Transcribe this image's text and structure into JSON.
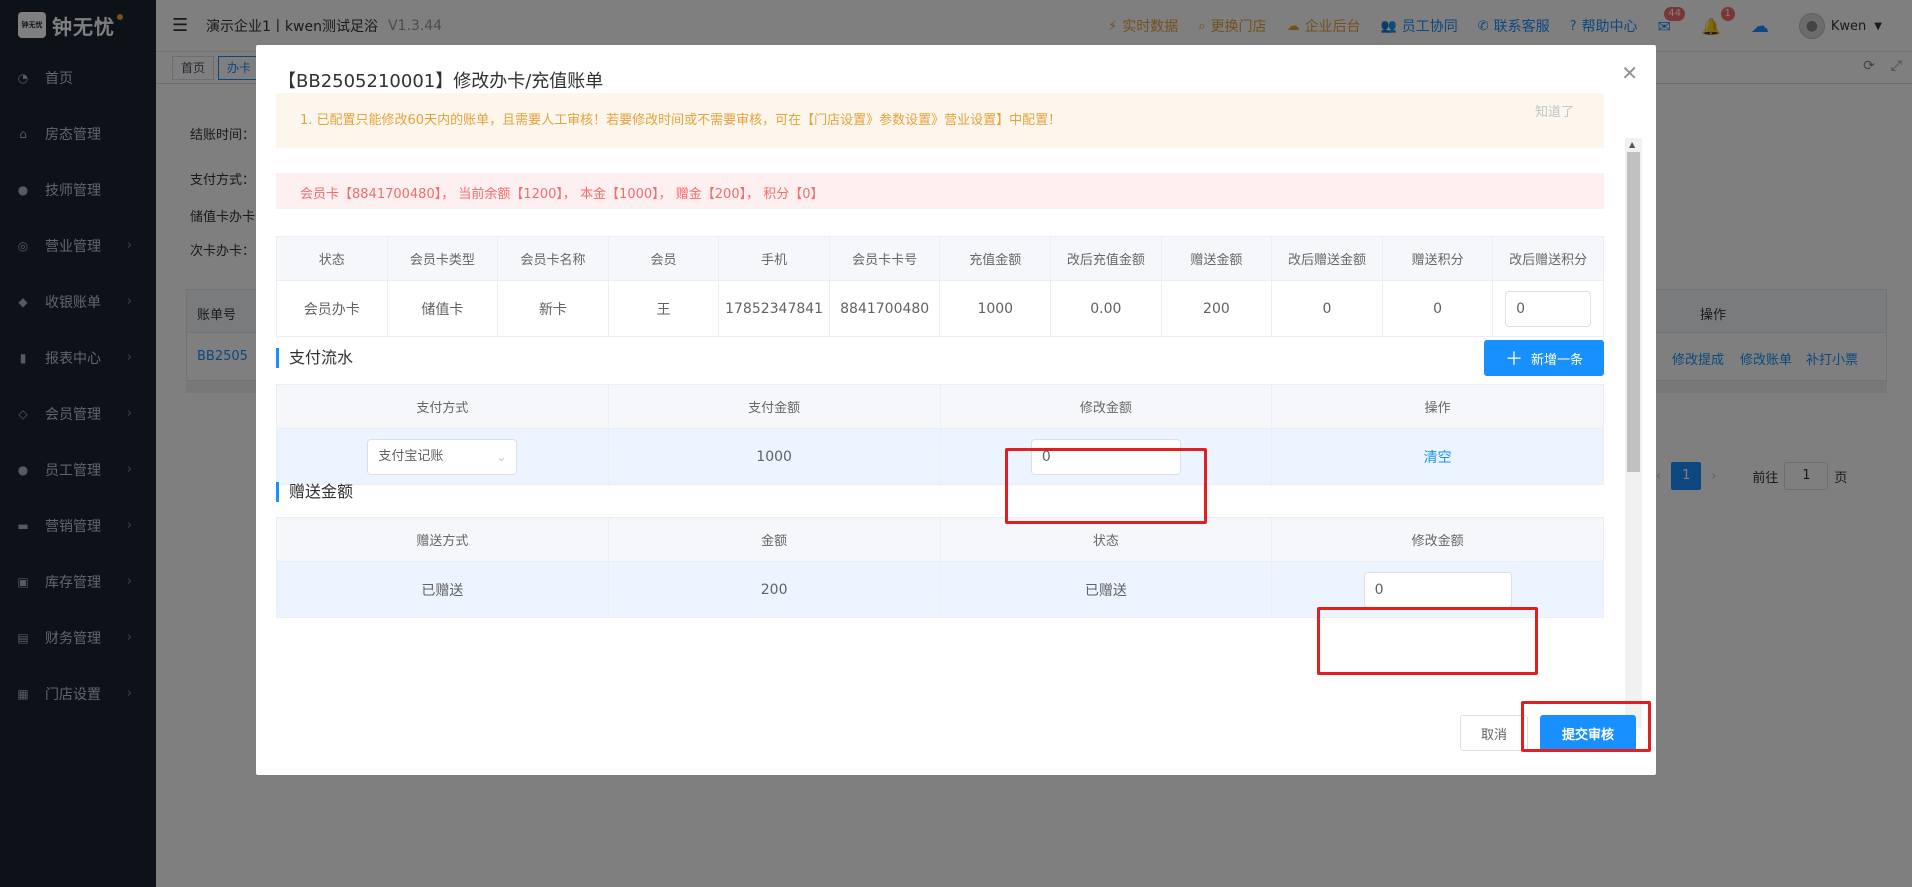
{
  "app": {
    "logo_text": "钟无忧",
    "logo_small": "钟无忧"
  },
  "sidebar": {
    "items": [
      {
        "label": "首页",
        "icon": "dashboard-icon",
        "chev": false
      },
      {
        "label": "房态管理",
        "icon": "home-icon",
        "chev": false
      },
      {
        "label": "技师管理",
        "icon": "person-icon",
        "chev": false
      },
      {
        "label": "营业管理",
        "icon": "target-icon",
        "chev": true
      },
      {
        "label": "收银账单",
        "icon": "money-bag-icon",
        "chev": true
      },
      {
        "label": "报表中心",
        "icon": "bar-chart-icon",
        "chev": true
      },
      {
        "label": "会员管理",
        "icon": "diamond-icon",
        "chev": true
      },
      {
        "label": "员工管理",
        "icon": "person-icon",
        "chev": true
      },
      {
        "label": "营销管理",
        "icon": "briefcase-icon",
        "chev": true
      },
      {
        "label": "库存管理",
        "icon": "box-icon",
        "chev": true
      },
      {
        "label": "财务管理",
        "icon": "wallet-icon",
        "chev": true
      },
      {
        "label": "门店设置",
        "icon": "grid-icon",
        "chev": true
      }
    ]
  },
  "topbar": {
    "company": "演示企业1丨kwen测试足浴",
    "version": "V1.3.44",
    "links": [
      {
        "label": "实时数据",
        "icon": "pulse-icon"
      },
      {
        "label": "更换门店",
        "icon": "search-icon"
      },
      {
        "label": "企业后台",
        "icon": "cloud-icon"
      },
      {
        "label": "员工协同",
        "icon": "users-icon"
      },
      {
        "label": "联系客服",
        "icon": "phone-icon"
      },
      {
        "label": "帮助中心",
        "icon": "help-icon"
      }
    ],
    "mail_badge": "44",
    "bell_badge": "1",
    "user": "Kwen"
  },
  "tabs": [
    {
      "label": "首页"
    },
    {
      "label": "办卡"
    }
  ],
  "background": {
    "time_label": "结账时间：",
    "pay_label": "支付方式：",
    "stored_label": "储值卡办卡",
    "times_label": "次卡办卡：",
    "col_bill": "账单号",
    "col_op": "操作",
    "row_bill": "BB2505",
    "row_ops": [
      "修改提成",
      "修改账单",
      "补打小票"
    ],
    "page": "1",
    "goto_label": "前往",
    "goto_value": "1",
    "page_unit": "页"
  },
  "modal": {
    "title": "【BB2505210001】修改办卡/充值账单",
    "notice": "1. 已配置只能修改60天内的账单，且需要人工审核！若要修改时间或不需要审核，可在【门店设置》参数设置》营业设置】中配置！",
    "notice_dismiss": "知道了",
    "alert": "会员卡【8841700480】， 当前余额【1200】， 本金【1000】， 赠金【200】， 积分【0】",
    "card_table": {
      "headers": [
        "状态",
        "会员卡类型",
        "会员卡名称",
        "会员",
        "手机",
        "会员卡卡号",
        "充值金额",
        "改后充值金额",
        "赠送金额",
        "改后赠送金额",
        "赠送积分",
        "改后赠送积分"
      ],
      "row": [
        "会员办卡",
        "储值卡",
        "新卡",
        "王",
        "17852347841",
        "8841700480",
        "1000",
        "0.00",
        "200",
        "0",
        "0",
        "0"
      ]
    },
    "pay_section": "支付流水",
    "add_label": "新增一条",
    "pay_table": {
      "headers": [
        "支付方式",
        "支付金额",
        "修改金额",
        "操作"
      ],
      "method": "支付宝记账",
      "amount": "1000",
      "edit_value": "0",
      "clear": "清空"
    },
    "gift_section": "赠送金额",
    "gift_table": {
      "headers": [
        "赠送方式",
        "金额",
        "状态",
        "修改金额"
      ],
      "row": [
        "已赠送",
        "200",
        "已赠送"
      ],
      "edit_value": "0"
    },
    "cancel": "取消",
    "submit": "提交审核"
  }
}
